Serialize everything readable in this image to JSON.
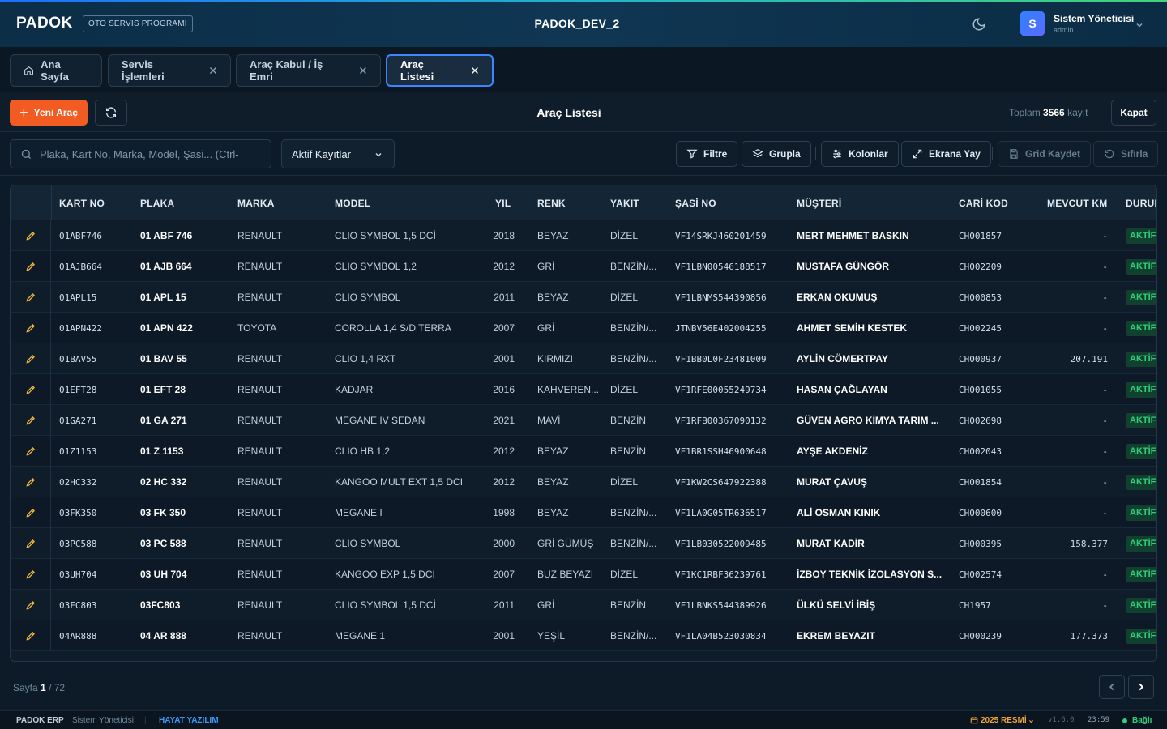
{
  "header": {
    "logo": "PADOK",
    "logo_tag": "OTO SERVİS PROGRAMI",
    "env": "PADOK_DEV_2",
    "user": {
      "initial": "S",
      "name": "Sistem Yöneticisi",
      "role": "admin"
    }
  },
  "tabs": [
    {
      "label": "Ana Sayfa",
      "icon": "home-icon",
      "closable": false,
      "active": false
    },
    {
      "label": "Servis İşlemleri",
      "closable": true,
      "active": false
    },
    {
      "label": "Araç Kabul / İş Emri",
      "closable": true,
      "active": false
    },
    {
      "label": "Araç Listesi",
      "closable": true,
      "active": true
    }
  ],
  "toolbar": {
    "new_label": "Yeni Araç",
    "title": "Araç Listesi",
    "total_prefix": "Toplam",
    "total_count": "3566",
    "total_suffix": "kayıt",
    "close_label": "Kapat"
  },
  "filters": {
    "search_placeholder": "Plaka, Kart No, Marka, Model, Şasi... (Ctrl-",
    "status_select": "Aktif Kayıtlar",
    "filter_label": "Filtre",
    "group_label": "Grupla",
    "columns_label": "Kolonlar",
    "fullscreen_label": "Ekrana Yay",
    "save_grid_label": "Grid Kaydet",
    "reset_label": "Sıfırla"
  },
  "grid": {
    "columns": [
      "KART NO",
      "PLAKA",
      "MARKA",
      "MODEL",
      "YIL",
      "RENK",
      "YAKIT",
      "ŞASİ NO",
      "MÜŞTERİ",
      "CARİ KOD",
      "MEVCUT KM",
      "DURUM"
    ],
    "rows": [
      [
        "01ABF746",
        "01 ABF 746",
        "RENAULT",
        "CLIO SYMBOL 1,5 DCİ",
        "2018",
        "BEYAZ",
        "DİZEL",
        "VF14SRKJ460201459",
        "MERT MEHMET BASKIN",
        "CH001857",
        "-",
        "AKTİF"
      ],
      [
        "01AJB664",
        "01 AJB 664",
        "RENAULT",
        "CLIO SYMBOL 1,2",
        "2012",
        "GRİ",
        "BENZİN/...",
        "VF1LBN00546188517",
        "MUSTAFA GÜNGÖR",
        "CH002209",
        "-",
        "AKTİF"
      ],
      [
        "01APL15",
        "01 APL 15",
        "RENAULT",
        "CLIO SYMBOL",
        "2011",
        "BEYAZ",
        "DİZEL",
        "VF1LBNMS544390856",
        "ERKAN OKUMUŞ",
        "CH000853",
        "-",
        "AKTİF"
      ],
      [
        "01APN422",
        "01 APN 422",
        "TOYOTA",
        "COROLLA 1,4 S/D TERRA",
        "2007",
        "GRİ",
        "BENZİN/...",
        "JTNBV56E402004255",
        "AHMET SEMİH KESTEK",
        "CH002245",
        "-",
        "AKTİF"
      ],
      [
        "01BAV55",
        "01 BAV 55",
        "RENAULT",
        "CLIO 1,4 RXT",
        "2001",
        "KIRMIZI",
        "BENZİN/...",
        "VF1BB0L0F23481009",
        "AYLİN CÖMERTPAY",
        "CH000937",
        "207.191",
        "AKTİF"
      ],
      [
        "01EFT28",
        "01 EFT 28",
        "RENAULT",
        "KADJAR",
        "2016",
        "KAHVEREN...",
        "DİZEL",
        "VF1RFE00055249734",
        "HASAN ÇAĞLAYAN",
        "CH001055",
        "-",
        "AKTİF"
      ],
      [
        "01GA271",
        "01 GA 271",
        "RENAULT",
        "MEGANE IV SEDAN",
        "2021",
        "MAVİ",
        "BENZİN",
        "VF1RFB00367090132",
        "GÜVEN AGRO KİMYA TARIM ...",
        "CH002698",
        "-",
        "AKTİF"
      ],
      [
        "01Z1153",
        "01 Z 1153",
        "RENAULT",
        "CLIO HB 1,2",
        "2012",
        "BEYAZ",
        "BENZİN",
        "VF1BR1SSH46900648",
        "AYŞE AKDENİZ",
        "CH002043",
        "-",
        "AKTİF"
      ],
      [
        "02HC332",
        "02 HC 332",
        "RENAULT",
        "KANGOO MULT EXT 1,5 DCI",
        "2012",
        "BEYAZ",
        "DİZEL",
        "VF1KW2CS647922388",
        "MURAT ÇAVUŞ",
        "CH001854",
        "-",
        "AKTİF"
      ],
      [
        "03FK350",
        "03 FK 350",
        "RENAULT",
        "MEGANE I",
        "1998",
        "BEYAZ",
        "BENZİN/...",
        "VF1LA0G05TR636517",
        "ALİ OSMAN KINIK",
        "CH000600",
        "-",
        "AKTİF"
      ],
      [
        "03PC588",
        "03 PC 588",
        "RENAULT",
        "CLIO SYMBOL",
        "2000",
        "GRİ GÜMÜŞ",
        "BENZİN/...",
        "VF1LB030522009485",
        "MURAT KADİR",
        "CH000395",
        "158.377",
        "AKTİF"
      ],
      [
        "03UH704",
        "03 UH 704",
        "RENAULT",
        "KANGOO EXP 1,5 DCI",
        "2007",
        "BUZ BEYAZI",
        "DİZEL",
        "VF1KC1RBF36239761",
        "İZBOY TEKNİK İZOLASYON S...",
        "CH002574",
        "-",
        "AKTİF"
      ],
      [
        "03FC803",
        "03FC803",
        "RENAULT",
        "CLIO SYMBOL 1,5 DCİ",
        "2011",
        "GRİ",
        "BENZİN",
        "VF1LBNKS544389926",
        "ÜLKÜ SELVİ İBİŞ",
        "CH1957",
        "-",
        "AKTİF"
      ],
      [
        "04AR888",
        "04 AR 888",
        "RENAULT",
        "MEGANE 1",
        "2001",
        "YEŞİL",
        "BENZİN/...",
        "VF1LA04B523030834",
        "EKREM BEYAZIT",
        "CH000239",
        "177.373",
        "AKTİF"
      ]
    ]
  },
  "pager": {
    "prefix": "Sayfa",
    "current": "1",
    "separator": "/ 72"
  },
  "status": {
    "app": "PADOK ERP",
    "user": "Sistem Yöneticisi",
    "company": "HAYAT YAZILIM",
    "period": "2025 RESMİ",
    "version": "v1.6.0",
    "time": "23:59",
    "connection": "Bağlı"
  },
  "colors": {
    "accent": "#f25c22",
    "active_tab": "#3d86ff",
    "status_ok": "#2fd07a"
  }
}
